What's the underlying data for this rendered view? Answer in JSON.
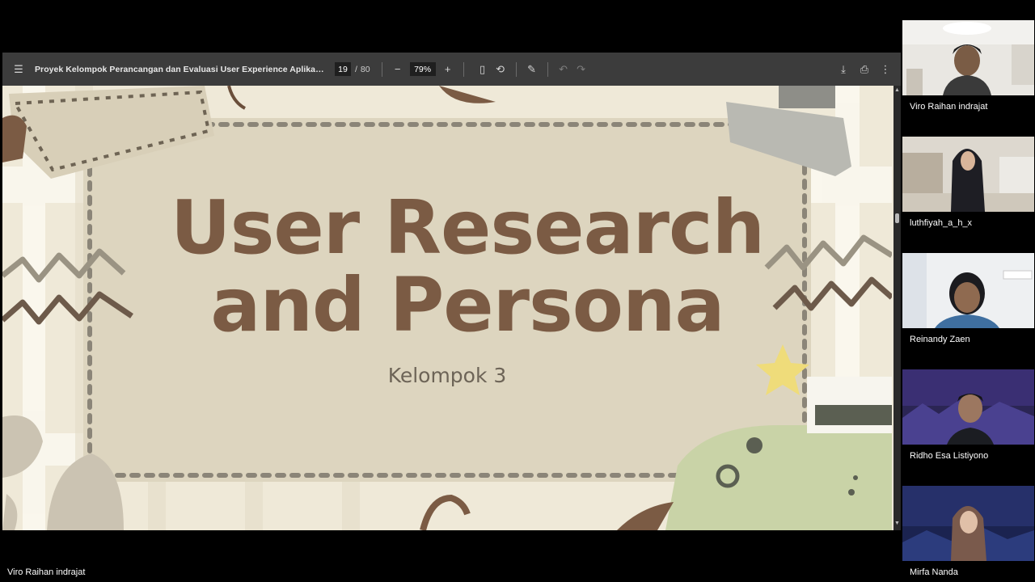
{
  "viewer": {
    "doc_title": "Proyek Kelompok Perancangan dan Evaluasi User Experience Aplikasi Lear...",
    "current_page": "19",
    "page_separator": "/",
    "total_pages": "80",
    "zoom": "79%",
    "icons": {
      "menu": "☰",
      "zoom_out": "−",
      "zoom_in": "+",
      "fit_page": "▯",
      "rotate": "⟲",
      "annotate": "✎",
      "undo": "↶",
      "redo": "↷",
      "download": "⤓",
      "print": "⎙",
      "more": "⋮"
    }
  },
  "slide": {
    "title_line1": "User Research",
    "title_line2": "and Persona",
    "subtitle": "Kelompok 3"
  },
  "participants": [
    {
      "name": "Viro Raihan indrajat"
    },
    {
      "name": "luthfiyah_a_h_x"
    },
    {
      "name": "Reinandy Zaen"
    },
    {
      "name": "Ridho Esa Listiyono"
    },
    {
      "name": "Mirfa Nanda"
    }
  ],
  "presenter_name": "Viro Raihan indrajat",
  "colors": {
    "toolbar": "#3c3c3c",
    "slide_bg": "#eee8d7",
    "title_brown": "#7b5b44"
  }
}
